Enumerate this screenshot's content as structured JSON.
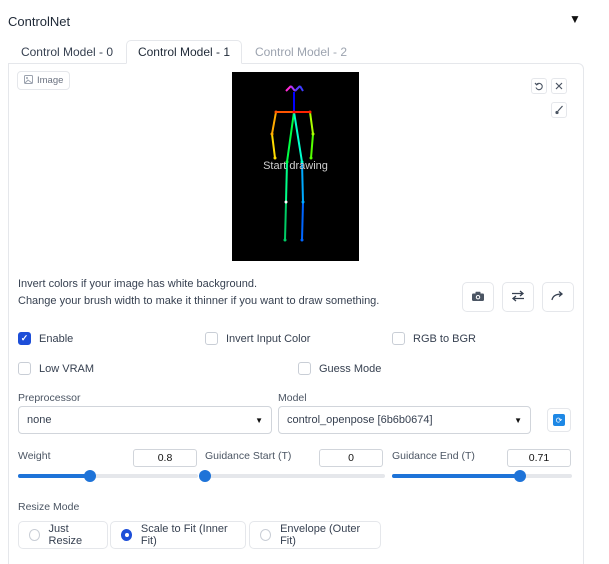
{
  "header": {
    "title": "ControlNet",
    "collapse_glyph": "▼"
  },
  "tabs": [
    {
      "label": "Control Model - 0",
      "state": "inactive"
    },
    {
      "label": "Control Model - 1",
      "state": "active"
    },
    {
      "label": "Control Model - 2",
      "state": "disabled"
    }
  ],
  "image_panel": {
    "label": "Image",
    "canvas_hint": "Start drawing",
    "canvas_bg": "#000000"
  },
  "help": {
    "line1": "Invert colors if your image has white background.",
    "line2": "Change your brush width to make it thinner if you want to draw something."
  },
  "options": {
    "enable": {
      "label": "Enable",
      "checked": true
    },
    "invert_input_color": {
      "label": "Invert Input Color",
      "checked": false
    },
    "rgb_to_bgr": {
      "label": "RGB to BGR",
      "checked": false
    },
    "low_vram": {
      "label": "Low VRAM",
      "checked": false
    },
    "guess_mode": {
      "label": "Guess Mode",
      "checked": false
    }
  },
  "preprocessor": {
    "label": "Preprocessor",
    "value": "none"
  },
  "model": {
    "label": "Model",
    "value": "control_openpose [6b6b0674]"
  },
  "weight": {
    "label": "Weight",
    "value": "0.8",
    "fraction": 0.4
  },
  "guidance_start": {
    "label": "Guidance Start (T)",
    "value": "0",
    "fraction": 0.0
  },
  "guidance_end": {
    "label": "Guidance End (T)",
    "value": "0.71",
    "fraction": 0.71
  },
  "resize_mode": {
    "label": "Resize Mode",
    "options": [
      {
        "label": "Just Resize",
        "checked": false
      },
      {
        "label": "Scale to Fit (Inner Fit)",
        "checked": true
      },
      {
        "label": "Envelope (Outer Fit)",
        "checked": false
      }
    ]
  },
  "colors": {
    "accent": "#1e73d8",
    "check": "#1d4ed8",
    "refresh": "#1e88e5"
  }
}
